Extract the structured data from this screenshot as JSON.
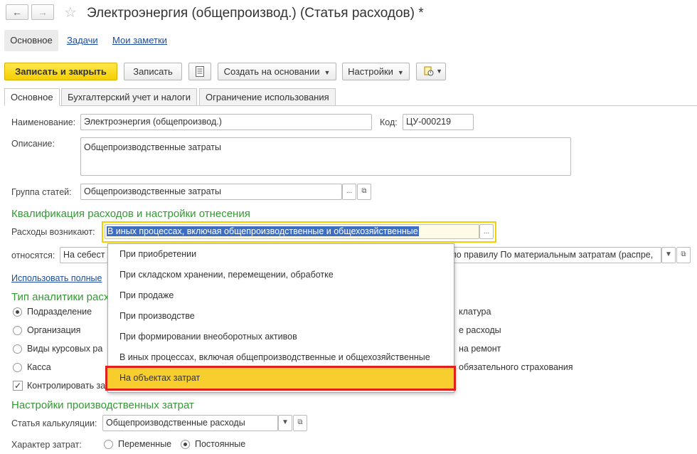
{
  "window": {
    "title": "Электроэнергия (общепроизвод.) (Статья расходов) *"
  },
  "top_tabs": {
    "main": "Основное",
    "tasks": "Задачи",
    "notes": "Мои заметки"
  },
  "toolbar": {
    "save_close": "Записать и закрыть",
    "save": "Записать",
    "create_based": "Создать на основании",
    "settings": "Настройки"
  },
  "form_tabs": [
    "Основное",
    "Бухгалтерский учет и налоги",
    "Ограничение использования"
  ],
  "fields": {
    "name_label": "Наименование:",
    "name_value": "Электроэнергия (общепроизвод.)",
    "code_label": "Код:",
    "code_value": "ЦУ-000219",
    "description_label": "Описание:",
    "description_value": "Общепроизводственные затраты",
    "group_label": "Группа статей:",
    "group_value": "Общепроизводственные затраты"
  },
  "qualification": {
    "section_title": "Квалификация расходов и настройки отнесения",
    "expenses_label": "Расходы возникают:",
    "expenses_value": "В иных процессах, включая общепроизводственные и общехозяйственные",
    "relates_label": "относятся:",
    "relates_value": "На себест",
    "rule_value": "по правилу По материальным затратам (распре,",
    "use_full_link": "Использовать полные"
  },
  "analytics": {
    "section_title": "Тип аналитики расх",
    "options_left": [
      "Подразделение",
      "Организация",
      "Виды курсовых ра",
      "Касса"
    ],
    "options_right": [
      "клатура",
      "е расходы",
      "на ремонт",
      "обязательного страхования"
    ],
    "control_label": "Контролировать зап"
  },
  "production": {
    "section_title": "Настройки производственных затрат",
    "calc_label": "Статья калькуляции:",
    "calc_value": "Общепроизводственные расходы",
    "nature_label": "Характер затрат:",
    "variable": "Переменные",
    "constant": "Постоянные"
  },
  "dropdown": {
    "items": [
      "При приобретении",
      "При складском хранении, перемещении, обработке",
      "При продаже",
      "При производстве",
      "При формировании внеоборотных активов",
      "В иных процессах, включая общепроизводственные и общехозяйственные"
    ],
    "selected": "На объектах затрат"
  },
  "colors": {
    "primary_button": "#f5cf00",
    "section_title": "#339933",
    "highlight": "#f8cd2e",
    "highlight_border": "#e0201a",
    "selection": "#3c6fc4"
  }
}
